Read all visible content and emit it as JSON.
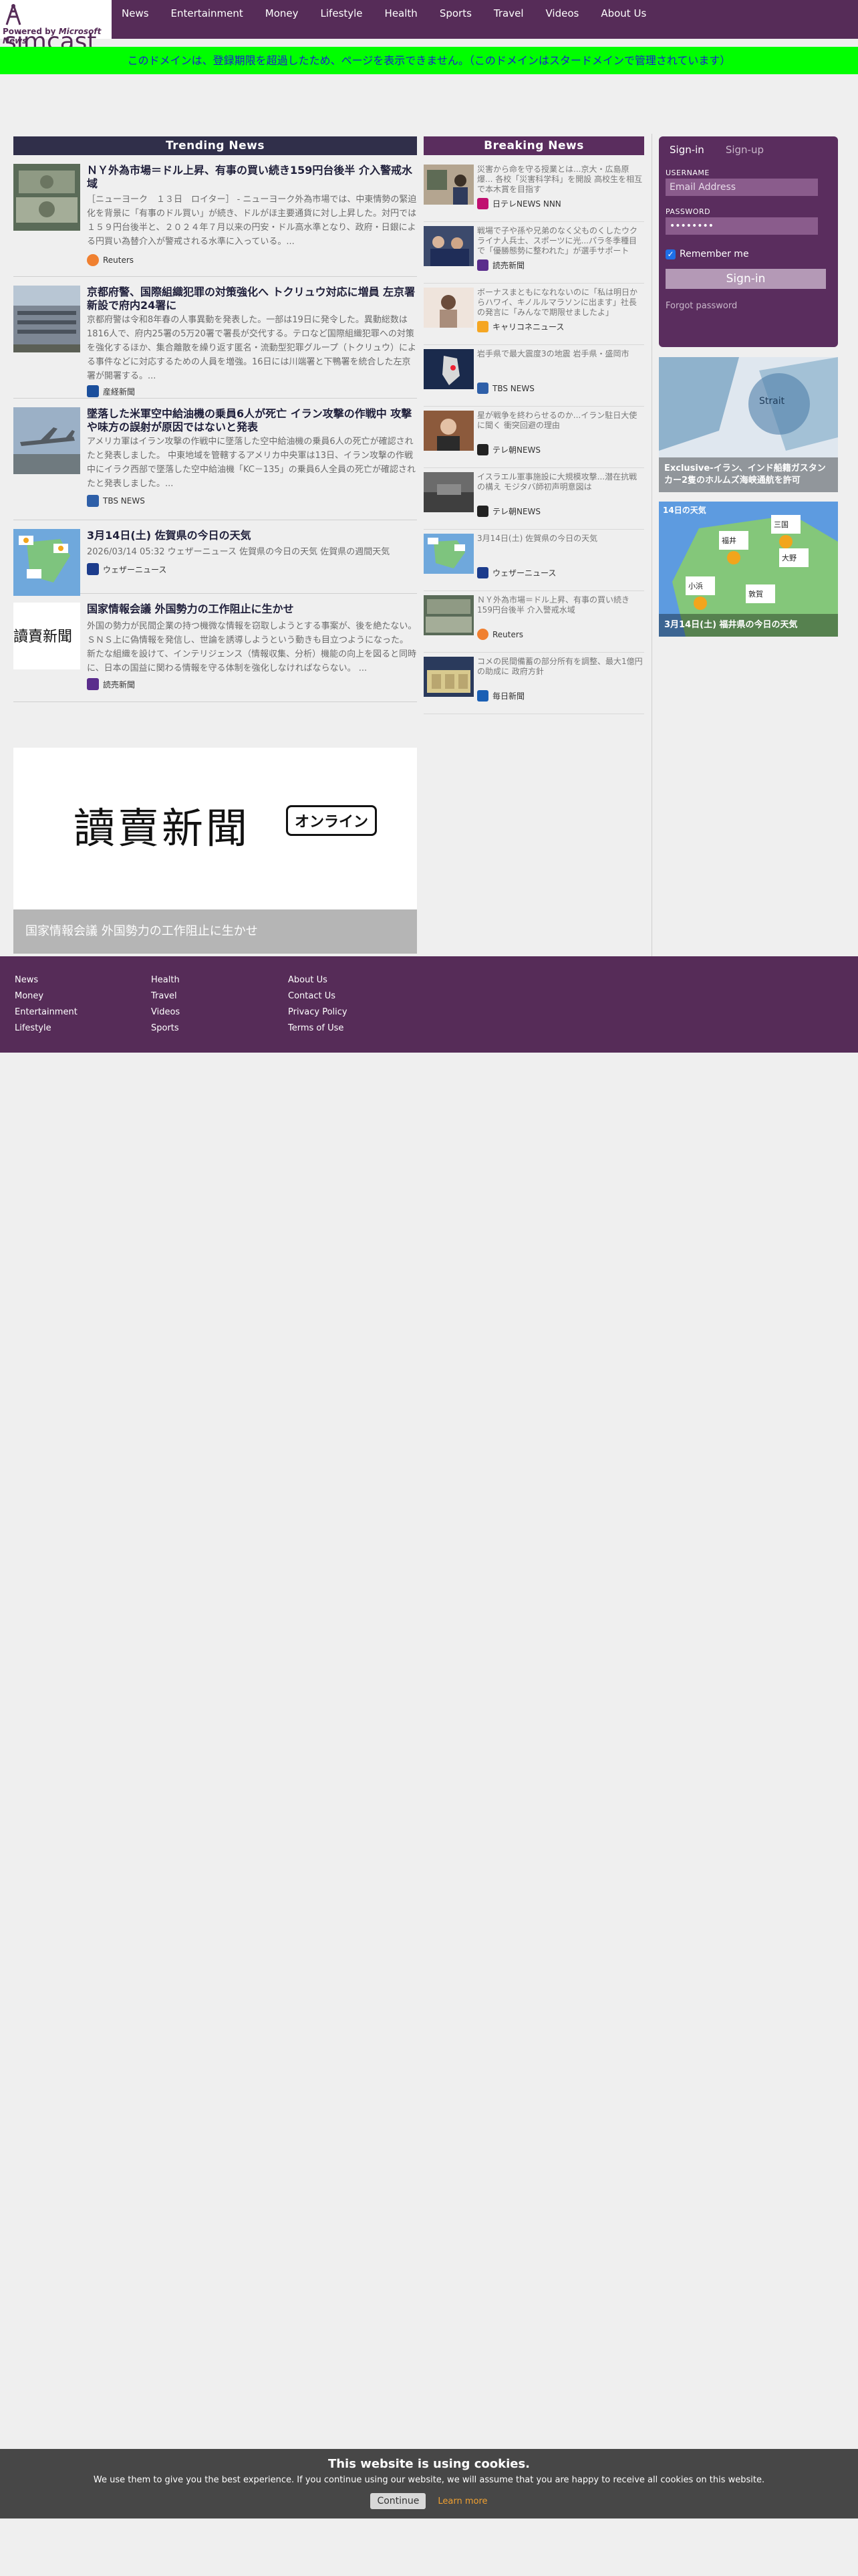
{
  "logo": {
    "text": "simcast",
    "powered": "Powered by",
    "powered_brand": "Microsoft News"
  },
  "nav": [
    "News",
    "Entertainment",
    "Money",
    "Lifestyle",
    "Health",
    "Sports",
    "Travel",
    "Videos",
    "About Us"
  ],
  "banner": "このドメインは、登録期限を超過したため、ページを表示できません。（このドメインはスタードメインで管理されています）",
  "trending": {
    "header": "Trending News",
    "items": [
      {
        "title": "ＮＹ外為市場＝ドル上昇、有事の買い続き159円台後半 介入警戒水域",
        "summary": "［ニューヨーク　１３日　ロイター］ - ニューヨーク外為市場では、中東情勢の緊迫化を背景に「有事のドル買い」が続き、ドルがほ主要通貨に対し上昇した。対円では１５９円台後半と、２０２４年７月以来の円安・ドル高水準となり、政府・日銀による円買い為替介入が警戒される水準に入っている。...",
        "source": "Reuters"
      },
      {
        "title": "京都府警、国際組織犯罪の対策強化へ トクリュウ対応に増員 左京署新設で府内24署に",
        "summary": "京都府警は令和8年春の人事異動を発表した。一部は19日に発令した。異動総数は1816人で、府内25署の5万20署で署長が交代する。テロなど国際組織犯罪への対策を強化するほか、集合離散を繰り返す匿名・流動型犯罪グループ（トクリュウ）による事件などに対応するための人員を増強。16日には川端署と下鴨署を統合した左京署が開署する。...",
        "source": "産経新聞"
      },
      {
        "title": "墜落した米軍空中給油機の乗員6人が死亡 イラン攻撃の作戦中 攻撃や味方の誤射が原因ではないと発表",
        "summary": "アメリカ軍はイラン攻撃の作戦中に墜落した空中給油機の乗員6人の死亡が確認されたと発表しました。 中東地域を管轄するアメリカ中央軍は13日、イラン攻撃の作戦中にイラク西部で墜落した空中給油機「KC－135」の乗員6人全員の死亡が確認されたと発表しました。...",
        "source": "TBS NEWS"
      },
      {
        "title": "3月14日(土) 佐賀県の今日の天気",
        "summary": "2026/03/14 05:32 ウェザーニュース 佐賀県の今日の天気 佐賀県の週間天気",
        "source": "ウェザーニュース"
      },
      {
        "title": "国家情報会議 外国勢力の工作阻止に生かせ",
        "summary": "外国の勢力が民間企業の持つ機微な情報を窃取しようとする事案が、後を絶たない。ＳＮＳ上に偽情報を発信し、世論を誘導しようという動きも目立つようになった。 新たな組織を設けて、インテリジェンス（情報収集、分析）機能の向上を図ると同時に、日本の国益に関わる情報を守る体制を強化しなければならない。 ...",
        "source": "読売新聞"
      }
    ]
  },
  "breaking": {
    "header": "Breaking News",
    "items": [
      {
        "text": "災害から命を守る授業とは...京大・広島原爆... 各校「災害科学科」を開設 高校生を相互で本木賞を目指す",
        "source": "日テレNEWS NNN"
      },
      {
        "text": "戦場で子や孫や兄弟のなく父ものくしたウクライナ人兵士、スポーツに光...パラ冬季種目で「優勝態勢に整われた」が選手サポート",
        "source": "読売新聞"
      },
      {
        "text": "ボーナスまともになれないのに「私は明日からハワイ、キノルルマラソンに出ます」社長の発言に「みんなで期限せましたよ」",
        "source": "キャリコネニュース"
      },
      {
        "text": "岩手県で最大震度3の地震 岩手県・盛岡市",
        "source": "TBS NEWS"
      },
      {
        "text": "星が戦争を終わらせるのか...イラン駐日大使に聞く 衝突回避の理由",
        "source": "テレ朝NEWS"
      },
      {
        "text": "イスラエル軍事施設に大規模攻撃...潜在抗戦の構え モジタバ師初声明意図は",
        "source": "テレ朝NEWS"
      },
      {
        "text": "3月14日(土) 佐賀県の今日の天気",
        "source": "ウェザーニュース"
      },
      {
        "text": "ＮＹ外為市場＝ドル上昇、有事の買い続き159円台後半 介入警戒水域",
        "source": "Reuters"
      },
      {
        "text": "コメの民間備蓄の部分所有を調整、最大1億円の助成に 政府方針",
        "source": "毎日新聞"
      }
    ]
  },
  "login": {
    "tab_signin": "Sign-in",
    "tab_signup": "Sign-up",
    "username_label": "USERNAME",
    "username_placeholder": "Email Address",
    "password_label": "PASSWORD",
    "password_value": "••••••••",
    "remember": "Remember me",
    "signin_button": "Sign-in",
    "forgot": "Forgot password"
  },
  "cards": [
    {
      "caption": "Exclusive-イラン、インド船籍ガスタンカー2隻のホルムズ海峡通航を許可"
    },
    {
      "caption": "3月14日(土) 福井県の今日の天気",
      "weather_title": "14日の天気",
      "cities": [
        "福井",
        "三国",
        "大野",
        "小浜",
        "敦賀"
      ]
    }
  ],
  "featured": {
    "logo_text": "讀賣新聞",
    "badge": "オンライン",
    "caption": "国家情報会議 外国勢力の工作阻止に生かせ"
  },
  "footer": {
    "col1": [
      "News",
      "Money",
      "Entertainment",
      "Lifestyle"
    ],
    "col2": [
      "Health",
      "Travel",
      "Videos",
      "Sports"
    ],
    "col3": [
      "About Us",
      "Contact Us",
      "Privacy Policy",
      "Terms of Use"
    ]
  },
  "cookie": {
    "title": "This website is using cookies.",
    "desc": "We use them to give you the best experience. If you continue using our website, we will assume that you are happy to receive all cookies on this website.",
    "continue": "Continue",
    "learn": "Learn more"
  },
  "colors": {
    "purple": "#562c58",
    "banner": "#00ff00",
    "trending_header": "#302f4a"
  }
}
